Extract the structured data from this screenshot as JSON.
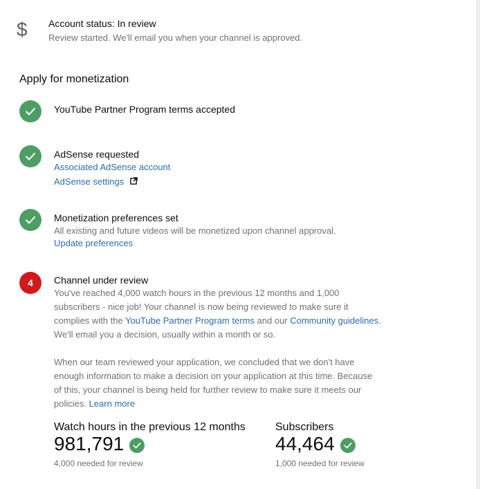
{
  "account": {
    "icon": "dollar-icon",
    "status_title": "Account status: In review",
    "status_sub": "Review started. We'll email you when your channel is approved."
  },
  "apply": {
    "heading": "Apply for monetization",
    "steps": [
      {
        "title": "YouTube Partner Program terms accepted",
        "state": "done"
      },
      {
        "title": "AdSense requested",
        "state": "done",
        "links": [
          "Associated AdSense account",
          "AdSense settings"
        ]
      },
      {
        "title": "Monetization preferences set",
        "state": "done",
        "description": "All existing and future videos will be monetized upon channel approval.",
        "link": "Update preferences"
      },
      {
        "title": "Channel under review",
        "state": "current",
        "number": "4",
        "para1_a": "You've reached 4,000 watch hours in the previous 12 months and 1,000",
        "para1_b": "subscribers - nice job! Your channel is now being reviewed to make sure it",
        "para1_c_pre": "complies with the ",
        "para1_link1": "YouTube Partner Program terms",
        "para1_c_mid": " and our ",
        "para1_link2": "Community guidelines",
        "para1_c_end": ".",
        "para1_d": "We'll email you a decision, usually within a month or so.",
        "para2_a": "When our team reviewed your application, we concluded that we don't have",
        "para2_b": "enough information to make a decision on your application at this time. Because",
        "para2_c": "of this, your channel is being held for further review to make sure it meets our",
        "para2_d_pre": "policies. ",
        "para2_link": "Learn more"
      }
    ]
  },
  "stats": {
    "watch_hours": {
      "label": "Watch hours in the previous 12 months",
      "value": "981,791",
      "note": "4,000 needed for review"
    },
    "subscribers": {
      "label": "Subscribers",
      "value": "44,464",
      "note": "1,000 needed for review"
    }
  },
  "colors": {
    "success": "#4d9e64",
    "alert": "#d21a1a",
    "link": "#2b6cb0"
  }
}
